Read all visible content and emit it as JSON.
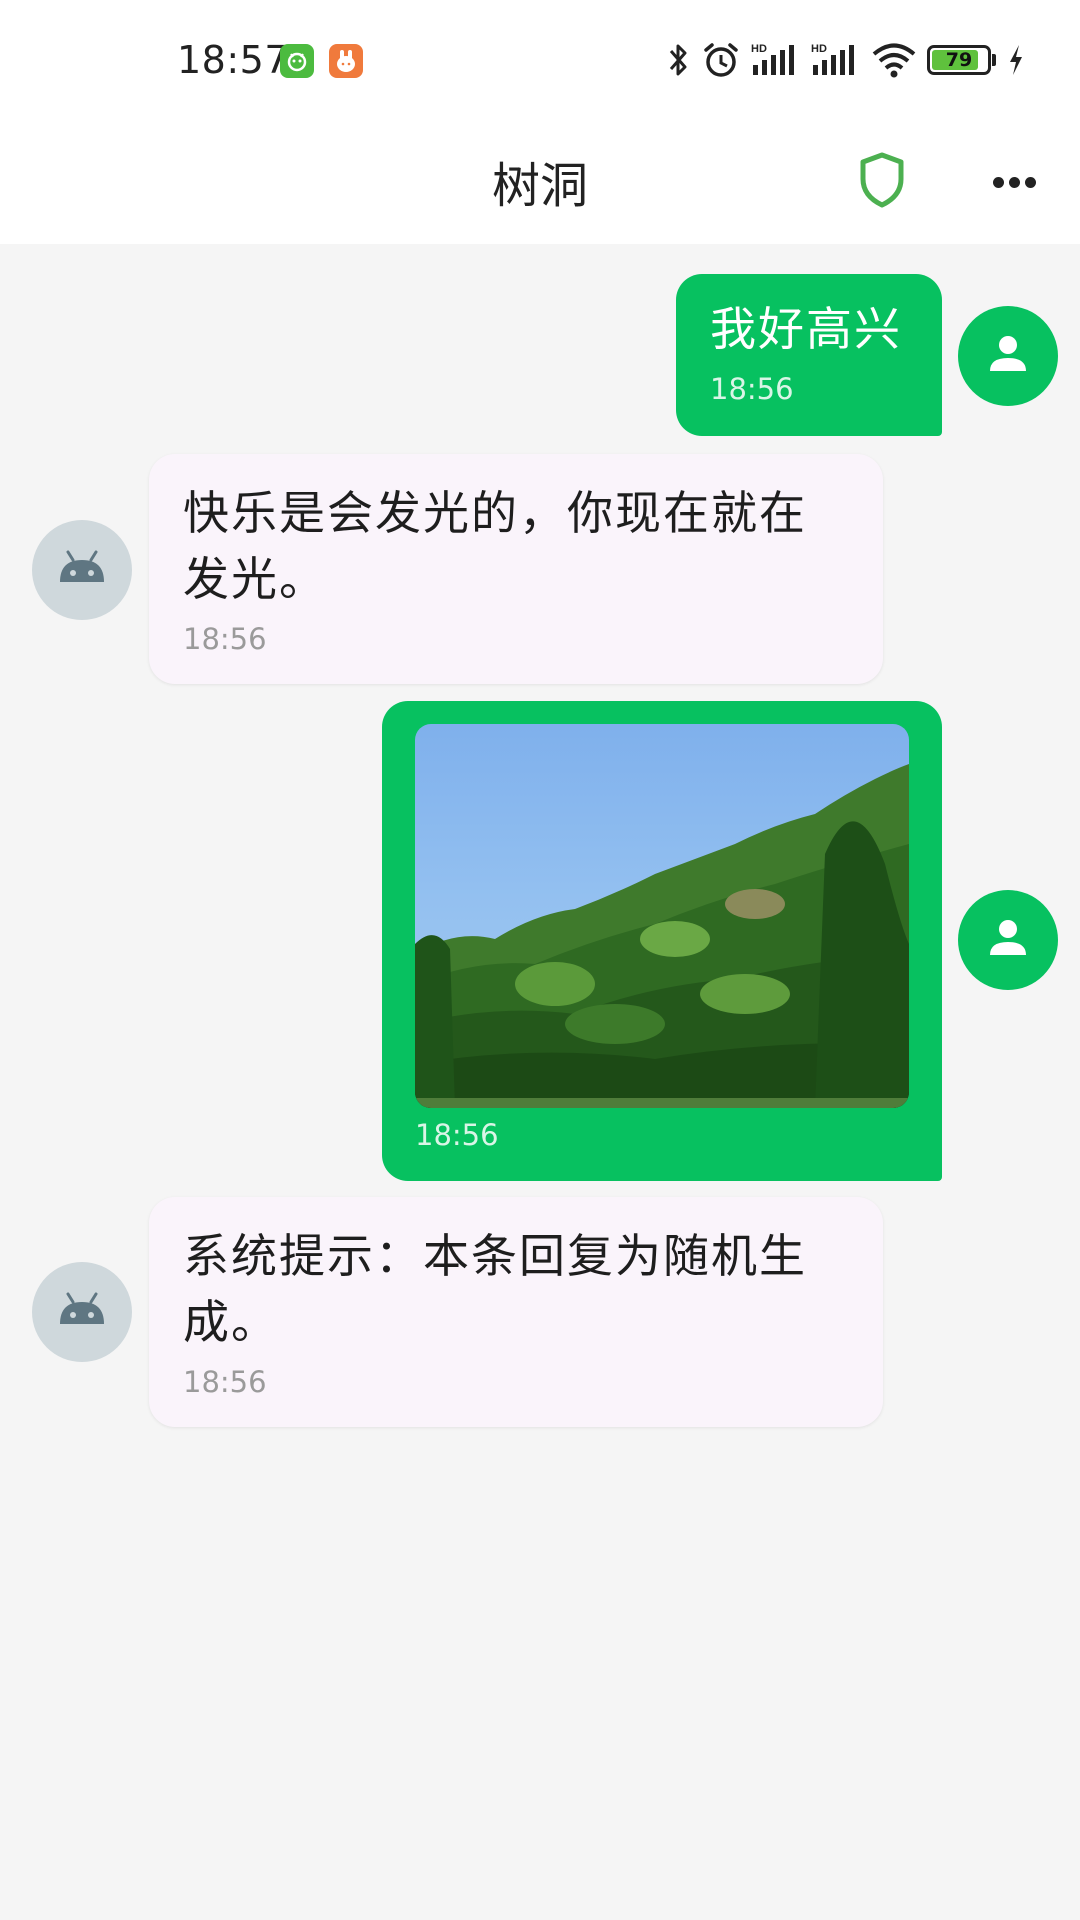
{
  "status_bar": {
    "time": "18:57",
    "battery_level": "79",
    "network_1": "HD",
    "network_2": "HD"
  },
  "header": {
    "title": "树洞",
    "shield_icon": "shield-icon",
    "more_icon": "more-icon"
  },
  "colors": {
    "accent": "#07c160",
    "bot_avatar_bg": "#cfd8dc",
    "bot_bubble_bg": "#faf4fb",
    "page_bg": "#f5f5f5"
  },
  "messages": [
    {
      "sender": "user",
      "text": "我好高兴",
      "time": "18:56"
    },
    {
      "sender": "bot",
      "text": "快乐是会发光的，你现在就在发光。",
      "time": "18:56"
    },
    {
      "sender": "user",
      "type": "image",
      "image_icon": "landscape-photo",
      "time": "18:56"
    },
    {
      "sender": "bot",
      "text": "系统提示：本条回复为随机生成。",
      "time": "18:56"
    }
  ]
}
